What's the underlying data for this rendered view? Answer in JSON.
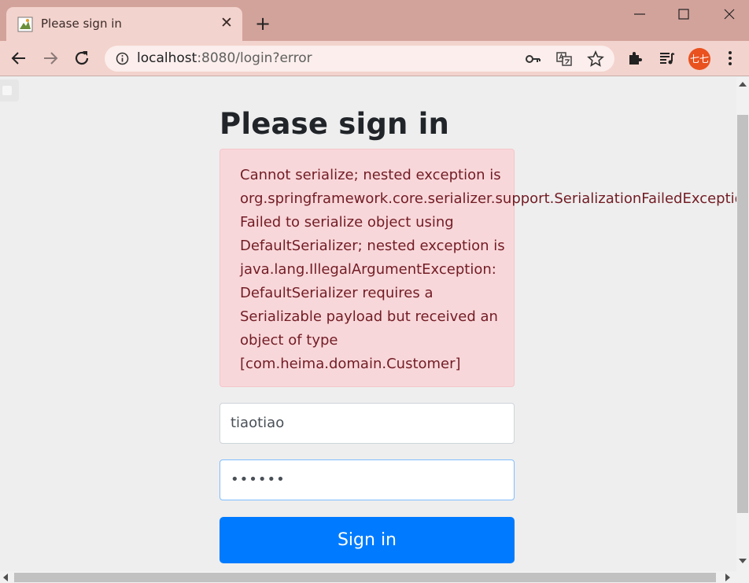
{
  "browser": {
    "tab_title": "Please sign in",
    "tab_close": "✕",
    "new_tab": "+",
    "url_host": "localhost",
    "url_path": ":8080/login?error",
    "avatar_text": "七七",
    "accent": "#d2a39b"
  },
  "page": {
    "heading": "Please sign in",
    "error_lines": [
      "Cannot serialize; nested exception is",
      "org.springframework.core.serializer.support.SerializationFailedException:",
      "Failed to serialize object using",
      "DefaultSerializer; nested exception is",
      "java.lang.IllegalArgumentException:",
      "DefaultSerializer requires a",
      "Serializable payload but received an",
      "object of type",
      "[com.heima.domain.Customer]"
    ],
    "username_value": "tiaotiao",
    "password_value": "••••••",
    "signin_label": "Sign in",
    "button_color": "#007bff",
    "alert_color": "#f8d7da"
  }
}
